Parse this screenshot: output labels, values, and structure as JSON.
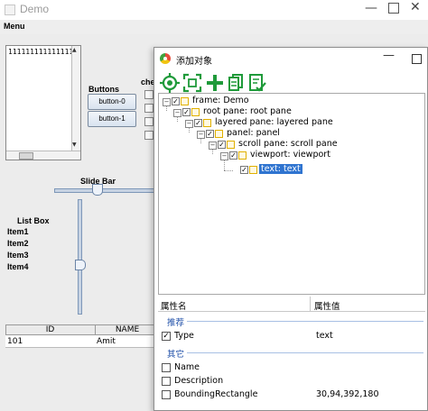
{
  "demo_window": {
    "title": "Demo",
    "menu_label": "Menu",
    "textarea_text": "111111111111111",
    "buttons_group_label": "Buttons",
    "button_0": "button-0",
    "button_1": "button-1",
    "checkbox_group_label": "che",
    "slide_bar_label": "Slide Bar",
    "slider_value_fraction": 0.42,
    "list_box_label": "List Box",
    "list_items": [
      "Item1",
      "Item2",
      "Item3",
      "Item4"
    ],
    "vertical_slider_value_fraction": 0.47,
    "table": {
      "headers": [
        "ID",
        "NAME"
      ],
      "rows": [
        [
          "101",
          "Amit"
        ]
      ]
    }
  },
  "dialog": {
    "title": "添加对象",
    "toolbar_icons": [
      "locate-icon",
      "capture-icon",
      "add-icon",
      "copy-icon",
      "validate-icon"
    ],
    "tree": [
      {
        "label": "frame: Demo",
        "checked": true,
        "selected": false
      },
      {
        "label": "root pane: root pane",
        "checked": true,
        "selected": false
      },
      {
        "label": "layered pane: layered pane",
        "checked": true,
        "selected": false
      },
      {
        "label": "panel: panel",
        "checked": true,
        "selected": false
      },
      {
        "label": "scroll pane: scroll pane",
        "checked": true,
        "selected": false
      },
      {
        "label": "viewport: viewport",
        "checked": true,
        "selected": false
      },
      {
        "label": "text: text",
        "checked": true,
        "selected": true
      }
    ],
    "properties": {
      "header_name": "属性名",
      "header_value": "属性值",
      "recommended_group": "推荐",
      "other_group": "其它",
      "rows": [
        {
          "name": "Type",
          "value": "text",
          "checked": true
        },
        {
          "name": "Name",
          "value": "",
          "checked": false
        },
        {
          "name": "Description",
          "value": "",
          "checked": false
        },
        {
          "name": "BoundingRectangle",
          "value": "30,94,392,180",
          "checked": false
        }
      ]
    }
  },
  "colors": {
    "selection": "#2f74d0",
    "toolbar_green": "#1f9a3a",
    "group_label": "#1f4fa8"
  }
}
